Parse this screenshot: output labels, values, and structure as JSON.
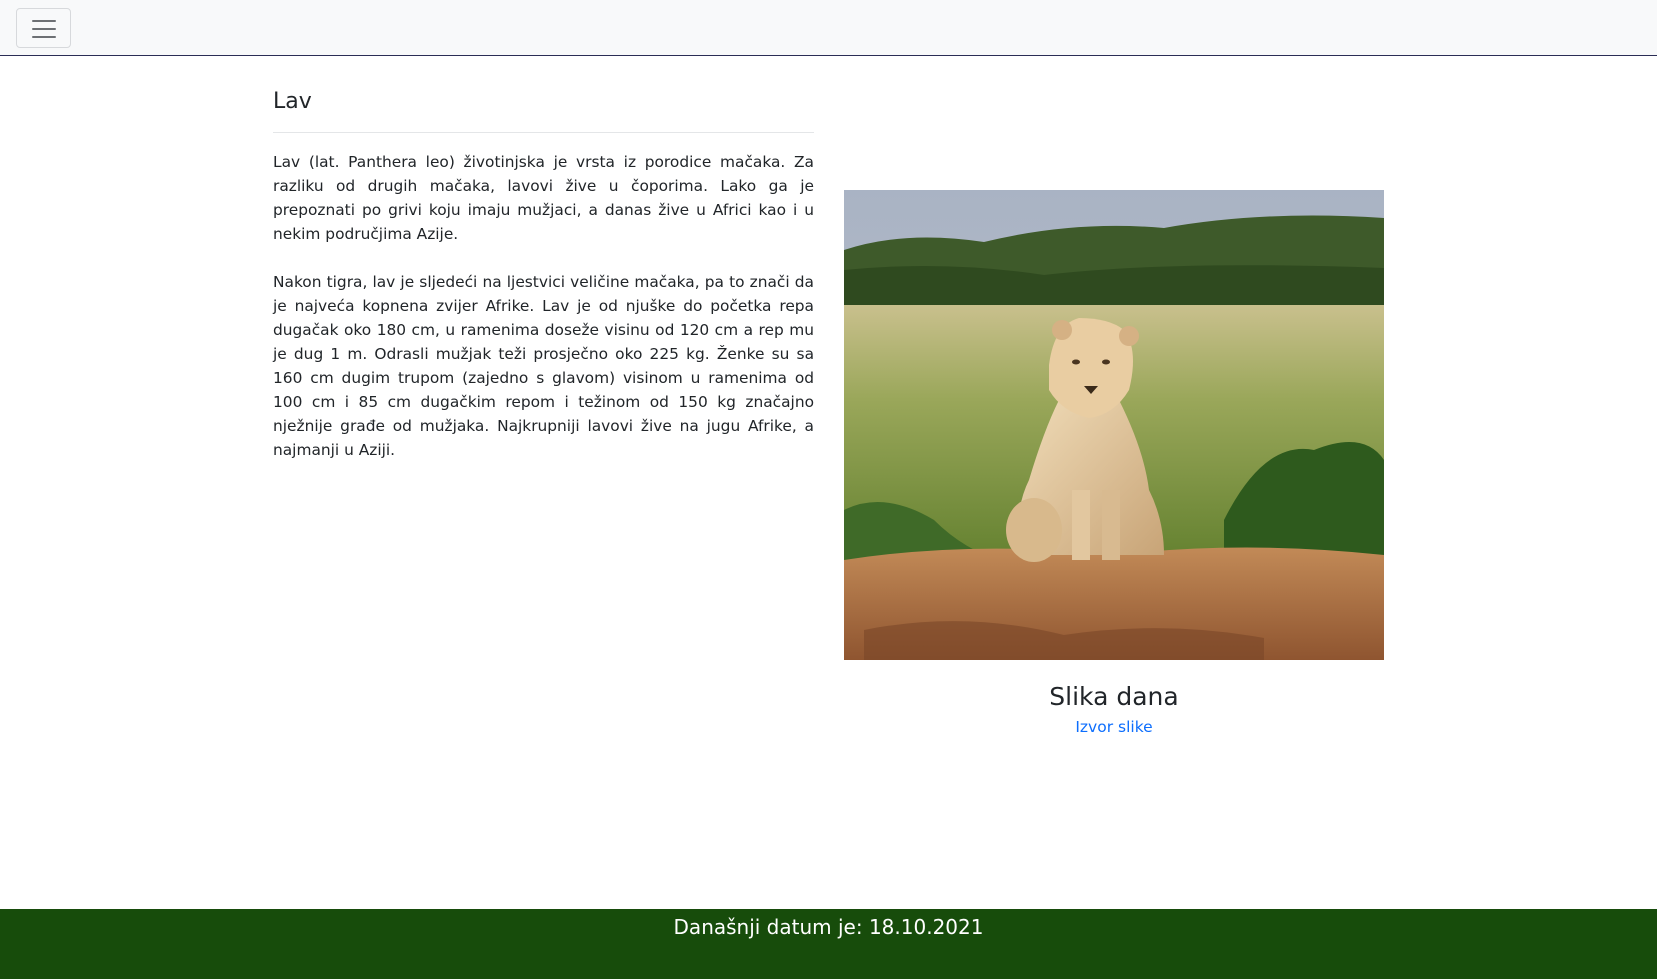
{
  "navbar": {
    "toggle_icon": "hamburger-icon"
  },
  "article": {
    "title": "Lav",
    "paragraphs": [
      "Lav (lat. Panthera leo) životinjska je vrsta iz porodice mačaka. Za razliku od drugih mačaka, lavovi žive u čoporima. Lako ga je prepoznati po grivi koju imaju mužjaci, a danas žive u Africi kao i u nekim područjima Azije.",
      "Nakon tigra, lav je sljedeći na ljestvici veličine mačaka, pa to znači da je najveća kopnena zvijer Afrike. Lav je od njuške do početka repa dugačak oko 180 cm, u ramenima doseže visinu od 120 cm a rep mu je dug 1 m. Odrasli mužjak teži prosječno oko 225 kg. Ženke su sa 160 cm dugim trupom (zajedno s glavom) visinom u ramenima od 100 cm i 85 cm dugačkim repom i težinom od 150 kg značajno nježnije građe od mužjaka. Najkrupniji lavovi žive na jugu Afrike, a najmanji u Aziji."
    ]
  },
  "picture": {
    "caption": "Slika dana",
    "source_link": "Izvor slike",
    "link_color": "#0d6efd"
  },
  "footer": {
    "date_text": "Današnji datum je: 18.10.2021",
    "background": "#174c0b"
  }
}
